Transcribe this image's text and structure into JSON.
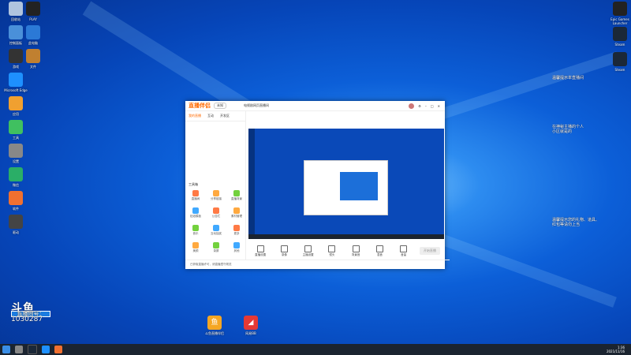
{
  "desktop_icons_left": [
    {
      "label": "回收站",
      "color": "#b0c4de"
    },
    {
      "label": "控制面板",
      "color": "#4a90d9"
    },
    {
      "label": "游戏",
      "color": "#333"
    },
    {
      "label": "Microsoft Edge",
      "color": "#1e90ff"
    },
    {
      "label": "应用",
      "color": "#f0a030"
    },
    {
      "label": "工具",
      "color": "#40c060"
    },
    {
      "label": "设置",
      "color": "#888"
    },
    {
      "label": "微信",
      "color": "#2aae67"
    },
    {
      "label": "软件",
      "color": "#f07030"
    },
    {
      "label": "驱动",
      "color": "#444"
    }
  ],
  "desktop_icons_col2": [
    {
      "label": "PLAY",
      "color": "#222"
    },
    {
      "label": "此电脑",
      "color": "#2b79d6"
    },
    {
      "label": "文件",
      "color": "#c08030"
    }
  ],
  "desktop_icons_right": [
    {
      "label": "Epic Games Launcher",
      "color": "#222"
    },
    {
      "label": "Steam",
      "color": "#1b2838"
    },
    {
      "label": "Steam",
      "color": "#1b2838"
    }
  ],
  "bottom_icons": [
    {
      "label": "斗鱼直播伴侣",
      "color": "#f5a623"
    },
    {
      "label": "网易BB",
      "color": "#e53935"
    }
  ],
  "stream_overlay": {
    "line1": "直播间号：",
    "room": "1030287",
    "texts": [
      "温馨提示本直播间",
      "在神秘主播的个人",
      "小区就是的",
      "温馨提示您的礼物、道具、",
      "红包等请勿上当"
    ]
  },
  "window": {
    "title": "直播伴侣",
    "badge": "未知",
    "live_room_title": "电视剧网页直播间",
    "tabs": [
      "我的直播",
      "互动",
      "开发区"
    ],
    "tools_label": "工具箱",
    "tools": [
      "直播间",
      "分享链接",
      "直播背景",
      "贴纸模板",
      "公告栏",
      "素材管理",
      "音乐",
      "互动抽奖",
      "更多",
      "美颜",
      "录屏",
      "其他"
    ],
    "controls": [
      "直播设置",
      "录像",
      "主播设置",
      "镜头",
      "背景音",
      "混音",
      "音量"
    ],
    "start_label": "开始直播",
    "status": "已获取直播许可，请直播遵守规范"
  },
  "taskbar": {
    "time": "1:36",
    "date": "2021/11/16"
  }
}
